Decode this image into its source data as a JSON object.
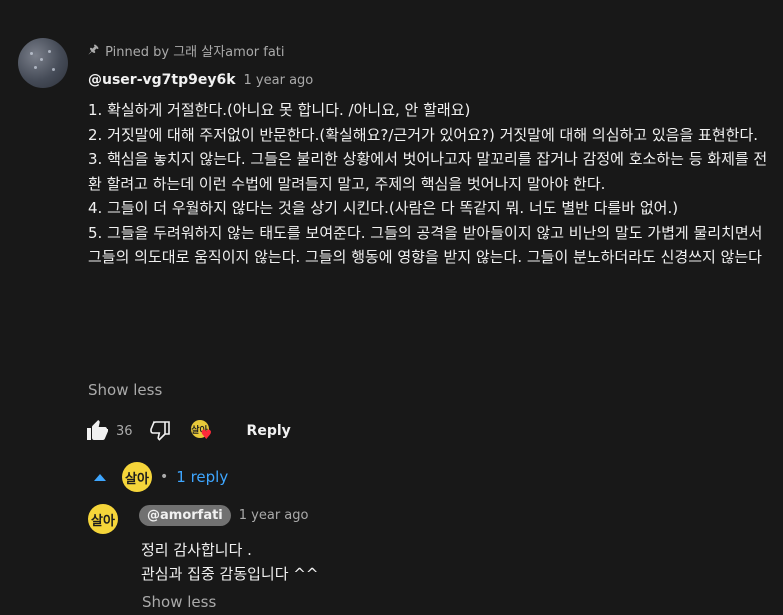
{
  "comment": {
    "pinned_label": "Pinned by 그래 살자amor fati",
    "author": "@user-vg7tp9ey6k",
    "time": "1 year ago",
    "lines": [
      "1. 확실하게 거절한다.(아니요 못 합니다. /아니요, 안 할래요)",
      "2. 거짓말에 대해 주저없이 반문한다.(확실해요?/근거가 있어요?) 거짓말에 대해 의심하고 있음을 표현한다.",
      "3. 핵심을 놓치지 않는다. 그들은 불리한 상황에서 벗어나고자  말꼬리를  잡거나 감정에 호소하는 등 화제를 전환 할려고 하는데 이런 수법에 말려들지 말고, 주제의 핵심을 벗어나지 말아야 한다.",
      "4. 그들이 더 우월하지 않다는 것을 상기 시킨다.(사람은 다 똑같지 뭐. 너도 별반 다를바 없어.)",
      "5. 그들을 두려워하지 않는 태도를 보여준다. 그들의 공격을 받아들이지 않고 비난의 말도 가볍게 물리치면서 그들의 의도대로 움직이지 않는다. 그들의 행동에 영향을 받지 않는다. 그들이 분노하더라도 신경쓰지 않는다"
    ],
    "show_less": "Show less",
    "like_count": "36",
    "reply_label": "Reply",
    "creator_avatar_text": "살아",
    "replies_count": "1 reply"
  },
  "reply": {
    "author": "@amorfati",
    "time": "1 year ago",
    "avatar_text": "살아",
    "lines": [
      "정리 감사합니다  .",
      "관심과 집중 감동입니다 ^^"
    ],
    "show_less": "Show less"
  },
  "colors": {
    "background": "#181818",
    "link": "#3ea6ff",
    "heart": "#ff2a3a",
    "creator_avatar": "#f5d53a"
  },
  "icons": [
    "pin-icon",
    "like-icon",
    "dislike-icon",
    "heart-icon",
    "caret-up-icon"
  ]
}
